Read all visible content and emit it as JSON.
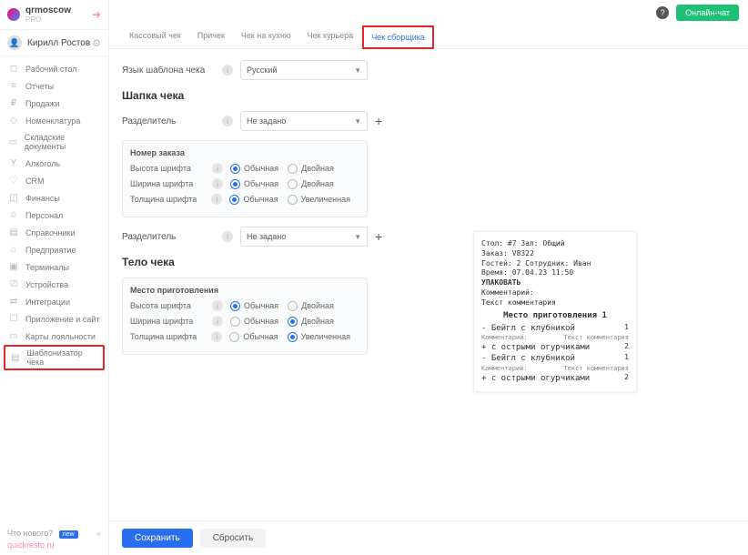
{
  "org": {
    "name": "qrmoscow",
    "sub": "PRO"
  },
  "user": {
    "name": "Кирилл Ростов"
  },
  "nav": [
    {
      "label": "Рабочий стол",
      "ic": "◻"
    },
    {
      "label": "Отчеты",
      "ic": "≡"
    },
    {
      "label": "Продажи",
      "ic": "₽"
    },
    {
      "label": "Номенклатура",
      "ic": "◇"
    },
    {
      "label": "Складские документы",
      "ic": "▭"
    },
    {
      "label": "Алкоголь",
      "ic": "Y"
    },
    {
      "label": "CRM",
      "ic": "♡"
    },
    {
      "label": "Финансы",
      "ic": "◫"
    },
    {
      "label": "Персонал",
      "ic": "☺"
    },
    {
      "label": "Справочники",
      "ic": "▤"
    },
    {
      "label": "Предприятие",
      "ic": "⌂"
    },
    {
      "label": "Терминалы",
      "ic": "▣"
    },
    {
      "label": "Устройства",
      "ic": "⎚"
    },
    {
      "label": "Интеграции",
      "ic": "⇄"
    },
    {
      "label": "Приложение и сайт",
      "ic": "☐"
    },
    {
      "label": "Карты лояльности",
      "ic": "▭"
    },
    {
      "label": "Шаблонизатор чека",
      "ic": "▤",
      "active": true
    }
  ],
  "footer": {
    "whatsnew": "Что нового?",
    "badge": "new",
    "domain": "quickresto.ru"
  },
  "topbar": {
    "chat": "Онлайн-чат"
  },
  "tabs": [
    {
      "label": "Кассовый чек"
    },
    {
      "label": "Причек"
    },
    {
      "label": "Чек на кухню"
    },
    {
      "label": "Чек курьера"
    },
    {
      "label": "Чек сборщика",
      "active": true
    }
  ],
  "form": {
    "lang_label": "Язык шаблона чека",
    "lang_value": "Русский",
    "header_title": "Шапка чека",
    "sep_label": "Разделитель",
    "sep_value": "Не задано",
    "body_title": "Тело чека",
    "group1_title": "Номер заказа",
    "group2_title": "Место приготовления",
    "opt_h": "Высота шрифта",
    "opt_w": "Ширина шрифта",
    "opt_t": "Толщина шрифта",
    "r_normal": "Обычная",
    "r_double": "Двойная",
    "r_bold": "Увеличенная"
  },
  "g1": {
    "h": "normal",
    "w": "normal",
    "t": "normal"
  },
  "g2": {
    "h": "normal",
    "w": "double",
    "t": "bold"
  },
  "preview": {
    "l1": "Стол: #7 Зал: Общий",
    "l2": "Заказ: V8322",
    "l3": "Гостей: 2 Сотрудник: Иван",
    "l4": "Время: 07.04.23 11:50",
    "l5": "УПАКОВАТЬ",
    "l6": "Комментарий:",
    "l7": "Текст комментария",
    "sect": "Место приготовления 1",
    "i1n": "- Бейгл с клубникой",
    "i1q": "1",
    "c1l": "Комментарий:",
    "c1t": "Текст комментария",
    "i2n": "+ с острыми огурчиками",
    "i2q": "2",
    "i3n": "- Бейгл с клубникой",
    "i3q": "1",
    "c2l": "Комментарий:",
    "c2t": "Текст комментария",
    "i4n": "+ с острыми огурчиками",
    "i4q": "2"
  },
  "actions": {
    "save": "Сохранить",
    "reset": "Сбросить"
  }
}
